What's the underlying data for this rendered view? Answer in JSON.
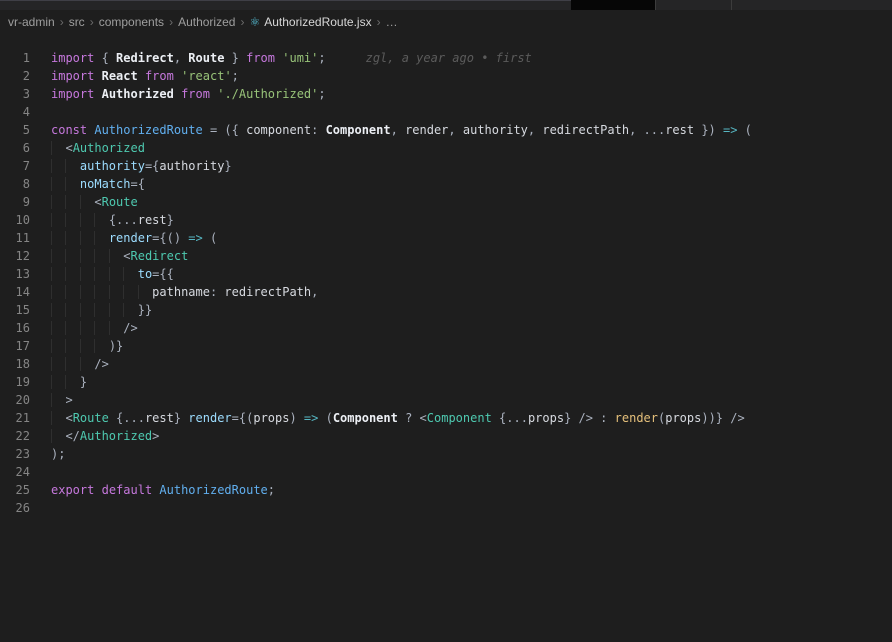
{
  "breadcrumb": {
    "path": [
      "vr-admin",
      "src",
      "components",
      "Authorized"
    ],
    "file": "AuthorizedRoute.jsx",
    "file_icon": "⚛",
    "separator": "›",
    "overflow": "…"
  },
  "editor": {
    "blame_annotation": "zgl, a year ago • first",
    "lines": [
      {
        "num": 1,
        "indent": 0,
        "blame": true,
        "tokens": [
          [
            "kw",
            "import"
          ],
          [
            "pun",
            " { "
          ],
          [
            "idb",
            "Redirect"
          ],
          [
            "pun",
            ", "
          ],
          [
            "idb",
            "Route"
          ],
          [
            "pun",
            " } "
          ],
          [
            "kw",
            "from"
          ],
          [
            "pun",
            " "
          ],
          [
            "str",
            "'umi'"
          ],
          [
            "pun",
            ";"
          ]
        ]
      },
      {
        "num": 2,
        "indent": 0,
        "tokens": [
          [
            "kw",
            "import"
          ],
          [
            "pun",
            " "
          ],
          [
            "idb",
            "React"
          ],
          [
            "pun",
            " "
          ],
          [
            "kw",
            "from"
          ],
          [
            "pun",
            " "
          ],
          [
            "str",
            "'react'"
          ],
          [
            "pun",
            ";"
          ]
        ]
      },
      {
        "num": 3,
        "indent": 0,
        "tokens": [
          [
            "kw",
            "import"
          ],
          [
            "pun",
            " "
          ],
          [
            "idb",
            "Authorized"
          ],
          [
            "pun",
            " "
          ],
          [
            "kw",
            "from"
          ],
          [
            "pun",
            " "
          ],
          [
            "str",
            "'./Authorized'"
          ],
          [
            "pun",
            ";"
          ]
        ]
      },
      {
        "num": 4,
        "indent": 0,
        "tokens": []
      },
      {
        "num": 5,
        "indent": 0,
        "tokens": [
          [
            "kw",
            "const"
          ],
          [
            "pun",
            " "
          ],
          [
            "fn",
            "AuthorizedRoute"
          ],
          [
            "pun",
            " = ({ "
          ],
          [
            "id",
            "component"
          ],
          [
            "pun",
            ": "
          ],
          [
            "idb",
            "Component"
          ],
          [
            "pun",
            ", "
          ],
          [
            "id",
            "render"
          ],
          [
            "pun",
            ", "
          ],
          [
            "id",
            "authority"
          ],
          [
            "pun",
            ", "
          ],
          [
            "id",
            "redirectPath"
          ],
          [
            "pun",
            ", ..."
          ],
          [
            "id",
            "rest"
          ],
          [
            "pun",
            " }) "
          ],
          [
            "arrow",
            "=>"
          ],
          [
            "pun",
            " ("
          ]
        ]
      },
      {
        "num": 6,
        "indent": 1,
        "tokens": [
          [
            "pun",
            "<"
          ],
          [
            "tag",
            "Authorized"
          ]
        ]
      },
      {
        "num": 7,
        "indent": 2,
        "tokens": [
          [
            "attr",
            "authority"
          ],
          [
            "pun",
            "={"
          ],
          [
            "id",
            "authority"
          ],
          [
            "pun",
            "}"
          ]
        ]
      },
      {
        "num": 8,
        "indent": 2,
        "tokens": [
          [
            "attr",
            "noMatch"
          ],
          [
            "pun",
            "={"
          ]
        ]
      },
      {
        "num": 9,
        "indent": 3,
        "tokens": [
          [
            "pun",
            "<"
          ],
          [
            "tag",
            "Route"
          ]
        ]
      },
      {
        "num": 10,
        "indent": 4,
        "tokens": [
          [
            "pun",
            "{..."
          ],
          [
            "id",
            "rest"
          ],
          [
            "pun",
            "}"
          ]
        ]
      },
      {
        "num": 11,
        "indent": 4,
        "tokens": [
          [
            "attr",
            "render"
          ],
          [
            "pun",
            "={() "
          ],
          [
            "arrow",
            "=>"
          ],
          [
            "pun",
            " ("
          ]
        ]
      },
      {
        "num": 12,
        "indent": 5,
        "tokens": [
          [
            "pun",
            "<"
          ],
          [
            "tag",
            "Redirect"
          ]
        ]
      },
      {
        "num": 13,
        "indent": 6,
        "tokens": [
          [
            "attr",
            "to"
          ],
          [
            "pun",
            "={{"
          ]
        ]
      },
      {
        "num": 14,
        "indent": 7,
        "tokens": [
          [
            "id",
            "pathname"
          ],
          [
            "pun",
            ": "
          ],
          [
            "id",
            "redirectPath"
          ],
          [
            "pun",
            ","
          ]
        ]
      },
      {
        "num": 15,
        "indent": 6,
        "tokens": [
          [
            "pun",
            "}}"
          ]
        ]
      },
      {
        "num": 16,
        "indent": 5,
        "tokens": [
          [
            "pun",
            "/>"
          ]
        ]
      },
      {
        "num": 17,
        "indent": 4,
        "tokens": [
          [
            "pun",
            ")}"
          ]
        ]
      },
      {
        "num": 18,
        "indent": 3,
        "tokens": [
          [
            "pun",
            "/>"
          ]
        ]
      },
      {
        "num": 19,
        "indent": 2,
        "tokens": [
          [
            "pun",
            "}"
          ]
        ]
      },
      {
        "num": 20,
        "indent": 1,
        "tokens": [
          [
            "pun",
            ">"
          ]
        ]
      },
      {
        "num": 21,
        "indent": 1,
        "tokens": [
          [
            "pun",
            "<"
          ],
          [
            "tag",
            "Route"
          ],
          [
            "pun",
            " {..."
          ],
          [
            "id",
            "rest"
          ],
          [
            "pun",
            "} "
          ],
          [
            "attr",
            "render"
          ],
          [
            "pun",
            "={("
          ],
          [
            "id",
            "props"
          ],
          [
            "pun",
            ") "
          ],
          [
            "arrow",
            "=>"
          ],
          [
            "pun",
            " ("
          ],
          [
            "idb",
            "Component"
          ],
          [
            "pun",
            " ? "
          ],
          [
            "pun",
            "<"
          ],
          [
            "tag",
            "Component"
          ],
          [
            "pun",
            " {..."
          ],
          [
            "id",
            "props"
          ],
          [
            "pun",
            "} /> : "
          ],
          [
            "fny",
            "render"
          ],
          [
            "pun",
            "("
          ],
          [
            "id",
            "props"
          ],
          [
            "pun",
            "))} />"
          ]
        ]
      },
      {
        "num": 22,
        "indent": 1,
        "tokens": [
          [
            "pun",
            "</"
          ],
          [
            "tag",
            "Authorized"
          ],
          [
            "pun",
            ">"
          ]
        ]
      },
      {
        "num": 23,
        "indent": 0,
        "tokens": [
          [
            "pun",
            ");"
          ]
        ]
      },
      {
        "num": 24,
        "indent": 0,
        "tokens": []
      },
      {
        "num": 25,
        "indent": 0,
        "tokens": [
          [
            "kw",
            "export"
          ],
          [
            "pun",
            " "
          ],
          [
            "kw",
            "default"
          ],
          [
            "pun",
            " "
          ],
          [
            "fn",
            "AuthorizedRoute"
          ],
          [
            "pun",
            ";"
          ]
        ]
      },
      {
        "num": 26,
        "indent": 0,
        "tokens": []
      }
    ]
  },
  "colors": {
    "editor_bg": "#1e1e1e",
    "tabbar_bg": "#252526",
    "react_icon_blue": "#58c4dc",
    "line_number": "#858585",
    "breadcrumb_text": "#9e9e9e",
    "breadcrumb_file": "#d8d8d8",
    "syntax": {
      "kw": "#c678dd",
      "str": "#98c379",
      "tag": "#4ec9b0",
      "attr": "#9cdcfe",
      "arrow": "#56b6c2",
      "fn": "#61afef",
      "fny": "#e5c07b",
      "id": "#d7dae0",
      "idb": "#eceff4",
      "pun": "#abb2bf",
      "blame": "#5b5b5b"
    }
  }
}
